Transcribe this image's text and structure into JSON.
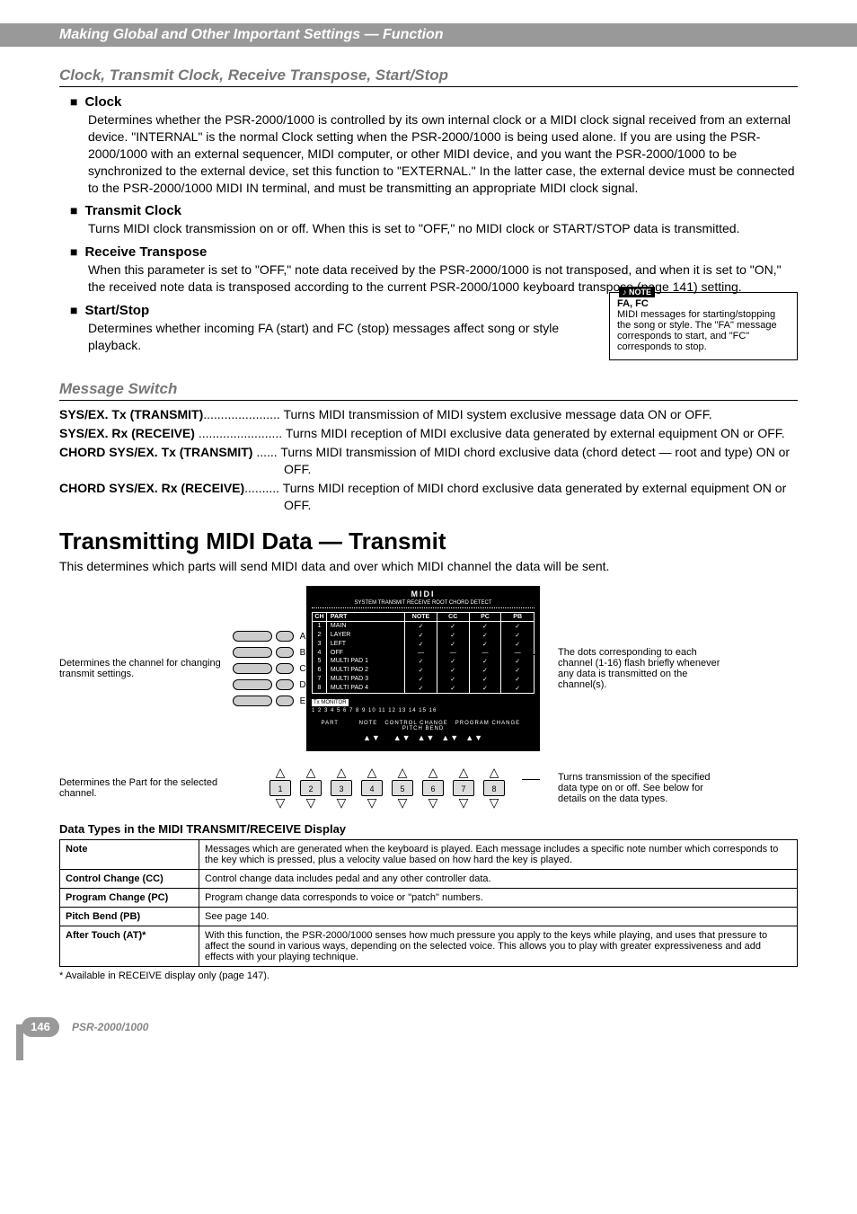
{
  "header": {
    "title": "Making Global and Other Important Settings — Function"
  },
  "section1": {
    "heading": "Clock, Transmit Clock, Receive Transpose, Start/Stop",
    "clock": {
      "title": "Clock",
      "body": "Determines whether the PSR-2000/1000 is controlled by its own internal clock or a MIDI clock signal received from an external device. \"INTERNAL\" is the normal Clock setting when the PSR-2000/1000 is being used alone. If you are using the PSR-2000/1000 with an external sequencer, MIDI computer, or other MIDI device, and you want the PSR-2000/1000 to be synchronized to the external device, set this function to \"EXTERNAL.\" In the latter case, the external device must be connected to the PSR-2000/1000 MIDI IN terminal, and must be transmitting an appropriate MIDI clock signal."
    },
    "transmit_clock": {
      "title": "Transmit Clock",
      "body": "Turns MIDI clock transmission on or off. When this is set to \"OFF,\" no MIDI clock or START/STOP data is transmitted."
    },
    "receive_transpose": {
      "title": "Receive Transpose",
      "body": "When this parameter is set to \"OFF,\" note data received by the PSR-2000/1000 is not transposed, and when it is set to \"ON,\" the received note data is transposed according to the current PSR-2000/1000 keyboard transpose (page 141) setting."
    },
    "start_stop": {
      "title": "Start/Stop",
      "body": "Determines whether incoming FA (start) and FC (stop) messages affect song or style playback."
    },
    "note_box": {
      "tag": "NOTE",
      "title": "FA, FC",
      "body": "MIDI messages for starting/stopping the song or style. The \"FA\" message corresponds to start, and \"FC\" corresponds to stop."
    }
  },
  "message_switch": {
    "heading": "Message Switch",
    "rows": [
      {
        "label": "SYS/EX. Tx (TRANSMIT)",
        "dots": "......................",
        "desc": "Turns MIDI transmission of MIDI system exclusive message data ON or OFF."
      },
      {
        "label": "SYS/EX. Rx (RECEIVE)",
        "dots": " ........................",
        "desc": "Turns MIDI reception of MIDI exclusive data generated by external equipment ON or OFF."
      },
      {
        "label": "CHORD SYS/EX. Tx (TRANSMIT)",
        "dots": " ......",
        "desc": "Turns MIDI transmission of MIDI chord exclusive data (chord detect — root and type) ON or OFF."
      },
      {
        "label": "CHORD SYS/EX. Rx (RECEIVE)",
        "dots": "..........",
        "desc": "Turns MIDI reception of MIDI chord exclusive data generated by external equipment ON or OFF."
      }
    ]
  },
  "transmit": {
    "heading": "Transmitting MIDI Data — Transmit",
    "intro": "This determines which parts will send MIDI data and over which MIDI channel the data will be sent.",
    "left_caption": "Determines the channel for changing transmit settings.",
    "right_caption": "The dots corresponding to each channel (1-16) flash briefly whenever any data is transmitted on the channel(s).",
    "lower_left_caption": "Determines the Part for the selected channel.",
    "lower_right_caption": "Turns transmission of the specified data type on or off. See below for details on the data types.",
    "screen": {
      "title": "MIDI",
      "tabs": "SYSTEM  TRANSMIT  RECEIVE  ROOT  CHORD DETECT",
      "headers": {
        "ch": "CH",
        "part": "PART",
        "note": "NOTE",
        "cc": "CC",
        "pc": "PC",
        "pb": "PB"
      },
      "rows": [
        {
          "ch": "1",
          "part": "MAIN",
          "note": "check",
          "cc": "check",
          "pc": "check",
          "pb": "check"
        },
        {
          "ch": "2",
          "part": "LAYER",
          "note": "check",
          "cc": "check",
          "pc": "check",
          "pb": "check"
        },
        {
          "ch": "3",
          "part": "LEFT",
          "note": "check",
          "cc": "check",
          "pc": "check",
          "pb": "check"
        },
        {
          "ch": "4",
          "part": "OFF",
          "note": "dash",
          "cc": "dash",
          "pc": "dash",
          "pb": "dash"
        },
        {
          "ch": "5",
          "part": "MULTI PAD 1",
          "note": "check",
          "cc": "check",
          "pc": "check",
          "pb": "check"
        },
        {
          "ch": "6",
          "part": "MULTI PAD 2",
          "note": "check",
          "cc": "check",
          "pc": "check",
          "pb": "check"
        },
        {
          "ch": "7",
          "part": "MULTI PAD 3",
          "note": "check",
          "cc": "check",
          "pc": "check",
          "pb": "check"
        },
        {
          "ch": "8",
          "part": "MULTI PAD 4",
          "note": "check",
          "cc": "check",
          "pc": "check",
          "pb": "check"
        }
      ],
      "txmon_label": "Tx MONITOR",
      "txmon_nums": "1 2 3 4 5 6 7 8 9 10 11 12 13 14 15 16",
      "bottom_labels": {
        "part": "PART",
        "note": "NOTE",
        "cc": "CONTROL CHANGE",
        "pc": "PROGRAM CHANGE",
        "pb": "PITCH BEND"
      }
    },
    "side_letters": [
      "A",
      "B",
      "C",
      "D",
      "E"
    ],
    "bottom_buttons": [
      "1",
      "2",
      "3",
      "4",
      "5",
      "6",
      "7",
      "8"
    ]
  },
  "table": {
    "caption": "Data Types in the MIDI TRANSMIT/RECEIVE Display",
    "rows": [
      {
        "h": "Note",
        "d": "Messages which are generated when the keyboard is played. Each message includes a specific note number which corresponds to the key which is pressed, plus a velocity value based on how hard the key is played."
      },
      {
        "h": "Control Change (CC)",
        "d": "Control change data includes pedal and any other controller data."
      },
      {
        "h": "Program Change (PC)",
        "d": "Program change data corresponds to voice or \"patch\" numbers."
      },
      {
        "h": "Pitch Bend (PB)",
        "d": "See page 140."
      },
      {
        "h": "After Touch (AT)*",
        "d": "With this function, the PSR-2000/1000 senses how much pressure you apply to the keys while playing, and uses that pressure to affect the sound in various ways, depending on the selected voice. This allows you to play with greater expressiveness and add effects with your playing technique."
      }
    ],
    "footnote": "* Available in RECEIVE display only (page 147)."
  },
  "footer": {
    "page": "146",
    "model": "PSR-2000/1000"
  }
}
